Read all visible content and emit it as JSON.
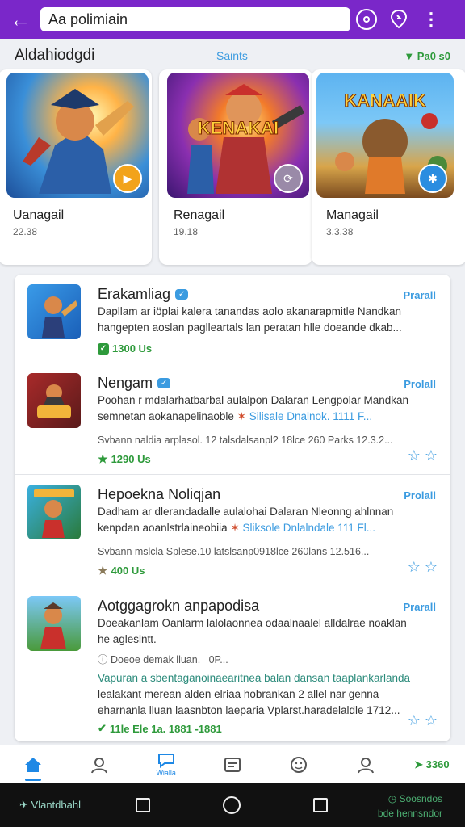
{
  "topbar": {
    "search_value": "Aa polimiain"
  },
  "featured": {
    "title": "Aldahiodgdi",
    "link": "Saints",
    "meta": "Pa0 s0",
    "cards": [
      {
        "name": "Uanagail",
        "meta": "22.38",
        "art_text": ""
      },
      {
        "name": "Renagail",
        "meta": "19.18",
        "art_text": "KENAKAI"
      },
      {
        "name": "Managail",
        "meta": "3.3.38",
        "art_text": "KANAAIK"
      }
    ]
  },
  "list": [
    {
      "title": "Erakamliag",
      "link": "Prarall",
      "desc": [
        "Dapllam ar iöplai kalera tanandas aolo akanarapmitle Nandkan",
        "hangepten aoslan paglleartals lan peratan hlle doeande dkab..."
      ],
      "rating": "1300 Us"
    },
    {
      "title": "Nengam",
      "link": "Prolall",
      "desc": [
        "Poohan r mdalarhatbarbal aulalpon Dalaran Lengpolar Mandkan",
        "semnetan aokanapelinaoble"
      ],
      "desc_hl": "Silisale Dnalnok. 1111 F...",
      "footer": "Svbann naldia arplasol. 12 talsdalsanpl2 18lce 260 Parks 12.3.2...",
      "rating": "1290 Us"
    },
    {
      "title": "Hepoekna Noliqjan",
      "link": "Prolall",
      "desc": [
        "Dadham ar dlerandadalle aulalohai Dalaran Nleonng ahlnnan",
        "kenpdan aoanlstrlaineobiia"
      ],
      "desc_hl": "Sliksole Dnlalndale 111 Fl...",
      "footer": "Svbann mslcla Splese.10 latslsanp0918lce 260lans 12.516...",
      "rating": "400 Us"
    },
    {
      "title": "Aotggagrokn anpapodisa",
      "link": "Prarall",
      "desc": [
        "Doeakanlam Oanlarm lalolaonnea odaalnaalel alldalrae noaklan",
        "he agleslntt."
      ],
      "sub": "Doeoe demak lluan.   0P...",
      "para": [
        "Vapuran a sbentaganoinaearitnea balan dansan taaplankarlanda",
        "lealakant merean alden elriaa hobrankan 2 allel nar genna",
        "eharnanla lluan laasnbton laeparia Vplarst.haradelaldle 1712..."
      ],
      "rating": "11le Ele 1a. 1881 -1881"
    }
  ],
  "bottom_nav": {
    "active_label": "Wialla",
    "score": "3360"
  },
  "system": {
    "left_text": "Vlantdbahl",
    "right_top": "Soosndos",
    "right_bottom": "bde hennsndor"
  }
}
